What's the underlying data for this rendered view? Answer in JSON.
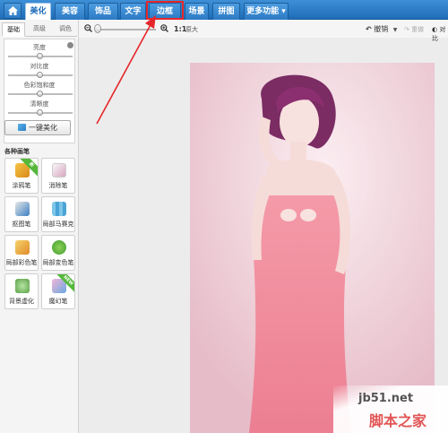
{
  "nav": {
    "tabs": [
      {
        "label": "美化",
        "active": true
      },
      {
        "label": "美容",
        "active": false
      },
      {
        "label": "饰品",
        "active": false
      },
      {
        "label": "文字",
        "active": false
      },
      {
        "label": "边框",
        "active": false,
        "highlighted": true
      },
      {
        "label": "场景",
        "active": false
      },
      {
        "label": "拼图",
        "active": false
      },
      {
        "label": "更多功能 ▾",
        "active": false
      }
    ],
    "home_icon": "home-icon",
    "highlight_color": "#e6262a"
  },
  "toolbar": {
    "ratio": "1:1",
    "original": "原大",
    "undo": "撤销",
    "redo": "重做",
    "compare": "对比"
  },
  "panel": {
    "subtabs": [
      "基础",
      "高级",
      "调色"
    ],
    "sliders": [
      {
        "label": "亮度",
        "value": 0.5
      },
      {
        "label": "对比度",
        "value": 0.5
      },
      {
        "label": "色彩饱和度",
        "value": 0.5
      },
      {
        "label": "清晰度",
        "value": 0.5
      }
    ],
    "auto_button": "一键美化",
    "section_title": "各种画笔",
    "tools": [
      {
        "label": "涂鸦笔",
        "icon": "brush-icon",
        "badge": "新"
      },
      {
        "label": "消除笔",
        "icon": "eraser-icon",
        "badge": ""
      },
      {
        "label": "抠图笔",
        "icon": "pen-icon",
        "badge": ""
      },
      {
        "label": "局部马赛克",
        "icon": "mosaic-icon",
        "badge": ""
      },
      {
        "label": "局部彩色笔",
        "icon": "color-brush-icon",
        "badge": ""
      },
      {
        "label": "局部变色笔",
        "icon": "recolor-icon",
        "badge": ""
      },
      {
        "label": "背景虚化",
        "icon": "blur-icon",
        "badge": ""
      },
      {
        "label": "魔幻笔",
        "icon": "magic-pen-icon",
        "badge": "NEW"
      }
    ]
  },
  "watermark": {
    "url": "jb51.net",
    "name": "脚本之家"
  },
  "colors": {
    "nav_blue": "#1f6db8",
    "arrow_red": "#e6262a",
    "ribbon_green": "#55b83b"
  }
}
